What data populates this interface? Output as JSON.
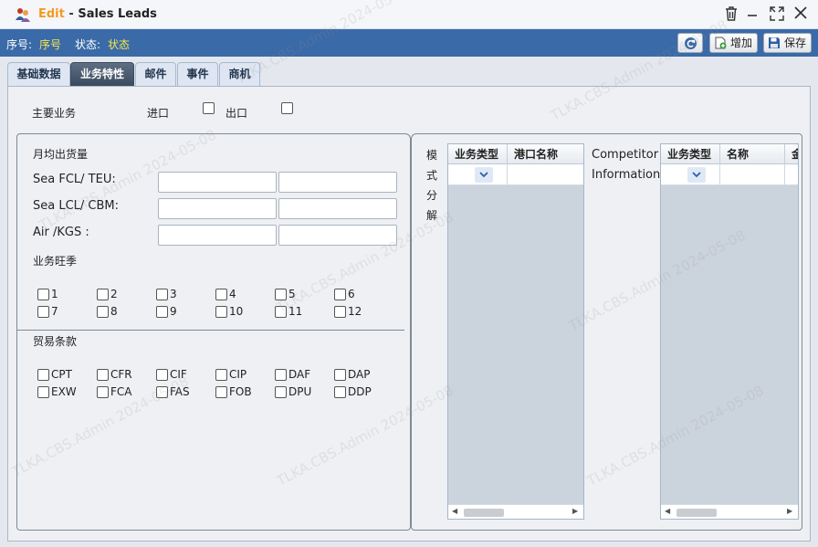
{
  "window": {
    "edit_label": "Edit",
    "separator": "-",
    "title": "Sales Leads"
  },
  "statusbar": {
    "seq_label": "序号:",
    "seq_value": "序号",
    "status_label": "状态:",
    "status_value": "状态",
    "add_label": "增加",
    "save_label": "保存"
  },
  "tabs": [
    "基础数据",
    "业务特性",
    "邮件",
    "事件",
    "商机"
  ],
  "main_business": {
    "label": "主要业务",
    "import_label": "进口",
    "export_label": "出口"
  },
  "volume": {
    "title": "月均出货量",
    "sea_fcl": "Sea  FCL/ TEU:",
    "sea_lcl": "Sea  LCL/ CBM:",
    "air": "Air /KGS :"
  },
  "season": {
    "title": "业务旺季",
    "months": [
      "1",
      "2",
      "3",
      "4",
      "5",
      "6",
      "7",
      "8",
      "9",
      "10",
      "11",
      "12"
    ]
  },
  "trade_terms": {
    "title": "贸易条款",
    "terms": [
      "CPT",
      "CFR",
      "CIF",
      "CIP",
      "DAF",
      "DAP",
      "EXW",
      "FCA",
      "FAS",
      "FOB",
      "DPU",
      "DDP"
    ]
  },
  "mode_split": {
    "label_chars": [
      "模",
      "式",
      "分",
      "解"
    ],
    "columns": [
      "业务类型",
      "港口名称"
    ]
  },
  "competitor": {
    "label_line1": "Competitor",
    "label_line2": "Information",
    "columns": [
      "业务类型",
      "名称",
      "金"
    ]
  },
  "watermark": "TLKA.CBS.Admin 2024-05-08"
}
